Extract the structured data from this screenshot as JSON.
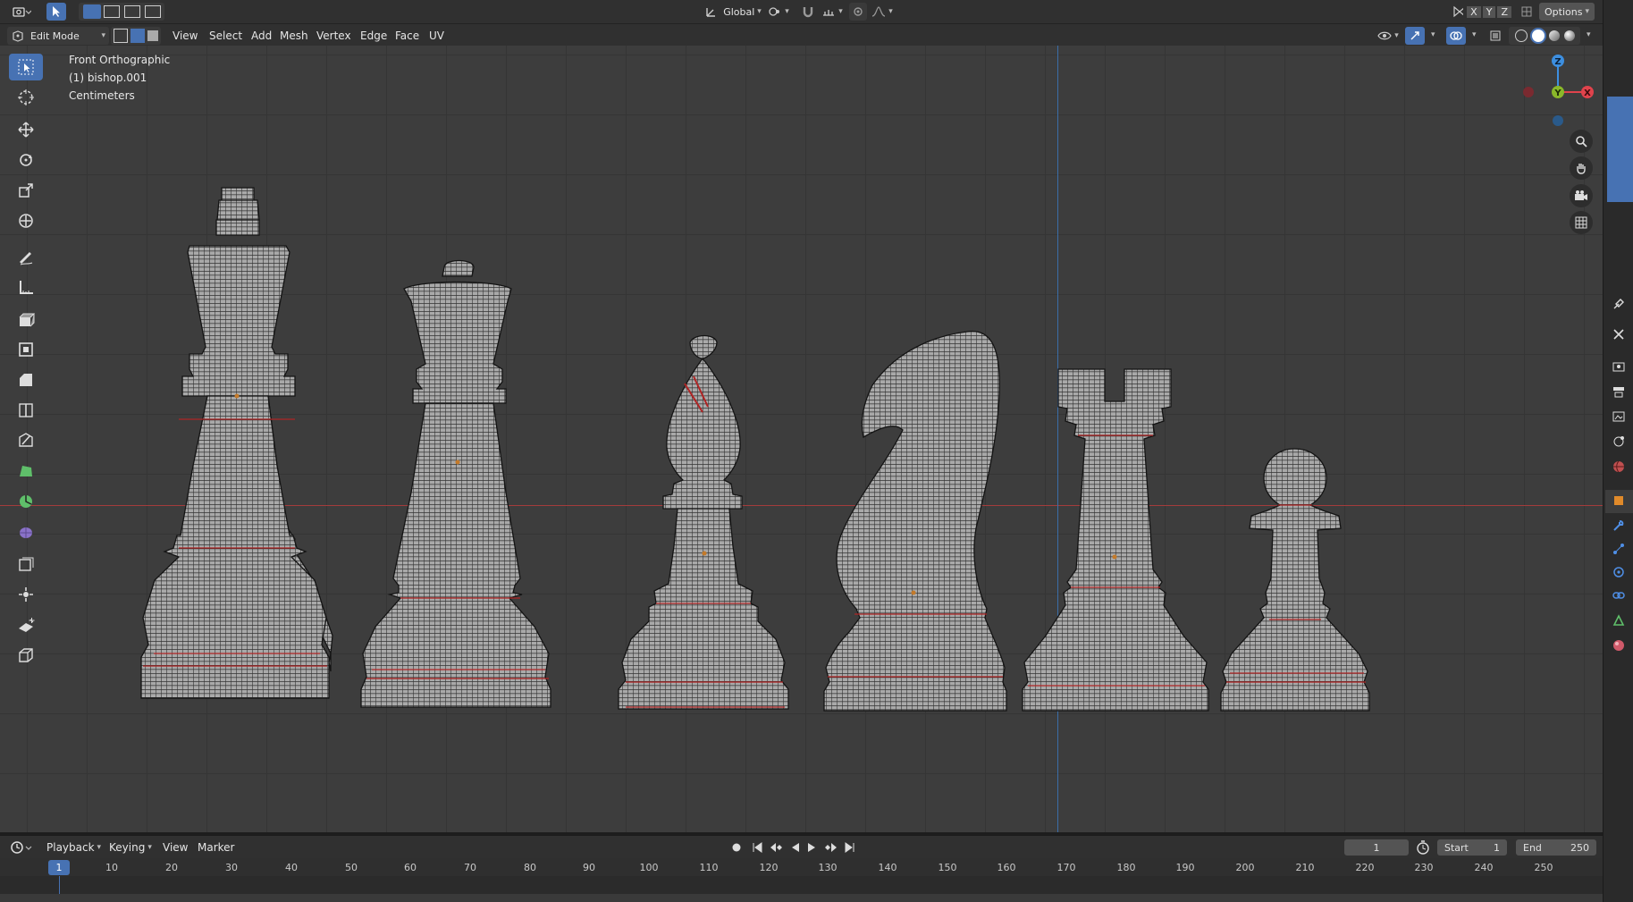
{
  "header": {
    "orientation_label": "Global",
    "options_label": "Options",
    "axes": [
      "X",
      "Y",
      "Z"
    ]
  },
  "mode_bar": {
    "mode_label": "Edit Mode",
    "menus": [
      "View",
      "Select",
      "Add",
      "Mesh",
      "Vertex",
      "Edge",
      "Face",
      "UV"
    ]
  },
  "viewport": {
    "view_name": "Front Orthographic",
    "object_name": "(1) bishop.001",
    "units": "Centimeters",
    "gizmo_axes": {
      "z": "Z",
      "y": "Y",
      "x": "X"
    },
    "pieces": [
      "king-piece",
      "queen-piece",
      "bishop-piece",
      "knight-piece",
      "rook-piece",
      "pawn-piece"
    ]
  },
  "toolbar_icons": [
    "select-box-icon",
    "cursor-icon",
    "move-icon",
    "rotate-icon",
    "scale-icon",
    "transform-icon",
    "annotate-icon",
    "measure-icon",
    "extrude-icon",
    "inset-icon",
    "bevel-icon",
    "loop-cut-icon",
    "knife-icon",
    "poly-build-icon",
    "spin-icon",
    "smooth-icon",
    "edge-slide-icon",
    "shrink-fatten-icon",
    "shear-icon",
    "rip-icon"
  ],
  "timeline": {
    "menus": [
      "Playback",
      "Keying",
      "View",
      "Marker"
    ],
    "current_frame": "1",
    "start_label": "Start",
    "start_value": "1",
    "end_label": "End",
    "end_value": "250",
    "ruler": [
      "10",
      "20",
      "30",
      "40",
      "50",
      "60",
      "70",
      "80",
      "90",
      "100",
      "110",
      "120",
      "130",
      "140",
      "150",
      "160",
      "170",
      "180",
      "190",
      "200",
      "210",
      "220",
      "230",
      "240",
      "250"
    ],
    "playhead_label": "1"
  },
  "colors": {
    "accent": "#4772b3",
    "x_axis": "#e0434c",
    "y_axis": "#8ab82a",
    "z_axis": "#3d8fe0",
    "mesh_fill": "#a8a8a8",
    "wire": "#1a1a1a",
    "seam": "#c22a2a"
  }
}
